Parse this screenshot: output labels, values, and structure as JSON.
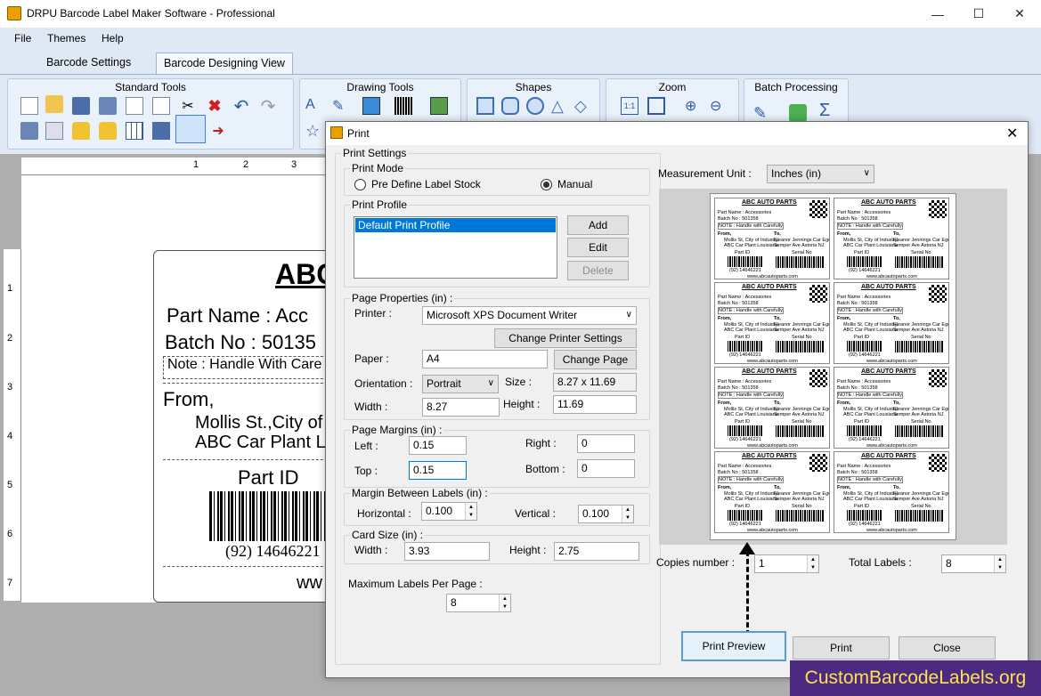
{
  "app": {
    "title": "DRPU Barcode Label Maker Software - Professional"
  },
  "menu": {
    "file": "File",
    "themes": "Themes",
    "help": "Help"
  },
  "tabs": {
    "barcode_settings": "Barcode Settings",
    "designing_view": "Barcode Designing View"
  },
  "ribbon": {
    "standard_tools": "Standard Tools",
    "drawing_tools": "Drawing Tools",
    "shapes": "Shapes",
    "zoom": "Zoom",
    "batch_processing": "Batch Processing"
  },
  "ruler": {
    "top": [
      "1",
      "2",
      "3"
    ],
    "left": [
      "1",
      "2",
      "3",
      "4",
      "5",
      "6",
      "7"
    ]
  },
  "label": {
    "company": "ABC",
    "part_name": "Part Name : Acc",
    "batch_no": "Batch No : 50135",
    "note": "Note : Handle With Care",
    "from": "From,",
    "address1": "Mollis St.,City of",
    "address2": "ABC Car Plant L",
    "part_id": "Part ID",
    "barcode_number": "(92) 14646221",
    "website": "ww"
  },
  "dialog": {
    "title": "Print",
    "print_settings": "Print Settings",
    "print_mode": "Print Mode",
    "mode_predefined": "Pre Define Label Stock",
    "mode_manual": "Manual",
    "print_profile": "Print Profile",
    "profile_selected": "Default Print Profile",
    "add": "Add",
    "edit": "Edit",
    "delete": "Delete",
    "page_properties": "Page Properties (in) :",
    "printer_label": "Printer :",
    "printer_value": "Microsoft XPS Document Writer",
    "change_printer": "Change Printer Settings",
    "paper_label": "Paper :",
    "paper_value": "A4",
    "change_page": "Change Page",
    "orientation_label": "Orientation :",
    "orientation_value": "Portrait",
    "size_label": "Size :",
    "size_value": "8.27 x 11.69",
    "width_label": "Width :",
    "width_value": "8.27",
    "height_label": "Height :",
    "height_value": "11.69",
    "page_margins": "Page Margins (in) :",
    "left_label": "Left :",
    "left_value": "0.15",
    "right_label": "Right :",
    "right_value": "0",
    "top_label": "Top :",
    "top_value": "0.15",
    "bottom_label": "Bottom :",
    "bottom_value": "0",
    "margin_between": "Margin Between Labels (in) :",
    "horizontal_label": "Horizontal :",
    "horizontal_value": "0.100",
    "vertical_label": "Vertical :",
    "vertical_value": "0.100",
    "card_size": "Card Size (in) :",
    "card_width_label": "Width :",
    "card_width_value": "3.93",
    "card_height_label": "Height :",
    "card_height_value": "2.75",
    "max_labels": "Maximum Labels Per Page :",
    "max_labels_value": "8",
    "measurement_label": "Measurement Unit :",
    "measurement_value": "Inches (in)",
    "copies_label": "Copies number :",
    "copies_value": "1",
    "total_label": "Total Labels :",
    "total_value": "8",
    "print_preview": "Print Preview",
    "print": "Print",
    "close": "Close"
  },
  "mini_label": {
    "company": "ABC AUTO PARTS",
    "part_name": "Part Name : Accessories",
    "batch_no": "Batch No : 501358",
    "note": "NOTE : Handle with Carefully",
    "from": "From,",
    "from_addr1": "Mollis St, City of Industry,",
    "from_addr2": "ABC Car Plant Louisiana",
    "to": "To,",
    "to_addr1": "Eleanor Jennings Car Egency",
    "to_addr2": "Semper Ave Astoria NJ",
    "part_id": "Part ID",
    "serial_no": "Serial No",
    "part_code": "(92) 14646221",
    "website": "www.abcautoparts.com"
  },
  "watermark": "CustomBarcodeLabels.org"
}
